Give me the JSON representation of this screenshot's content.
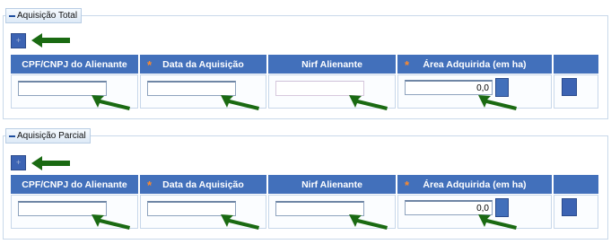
{
  "sections": [
    {
      "legend": "Aquisição Total",
      "headers": [
        "CPF/CNPJ do Alienante",
        "Data da Aquisição",
        "Nirf Alienante",
        "Área Adquirida (em ha)"
      ],
      "required_mark": "*",
      "area_value": "0,0",
      "add_symbol": "+"
    },
    {
      "legend": "Aquisição Parcial",
      "headers": [
        "CPF/CNPJ do Alienante",
        "Data da Aquisição",
        "Nirf Alienante",
        "Área Adquirida (em ha)"
      ],
      "required_mark": "*",
      "area_value": "0,0",
      "add_symbol": "+"
    }
  ],
  "colors": {
    "header_blue": "#4270bb",
    "arrow_green": "#1a6a12",
    "required_orange": "#ff8a2a"
  }
}
